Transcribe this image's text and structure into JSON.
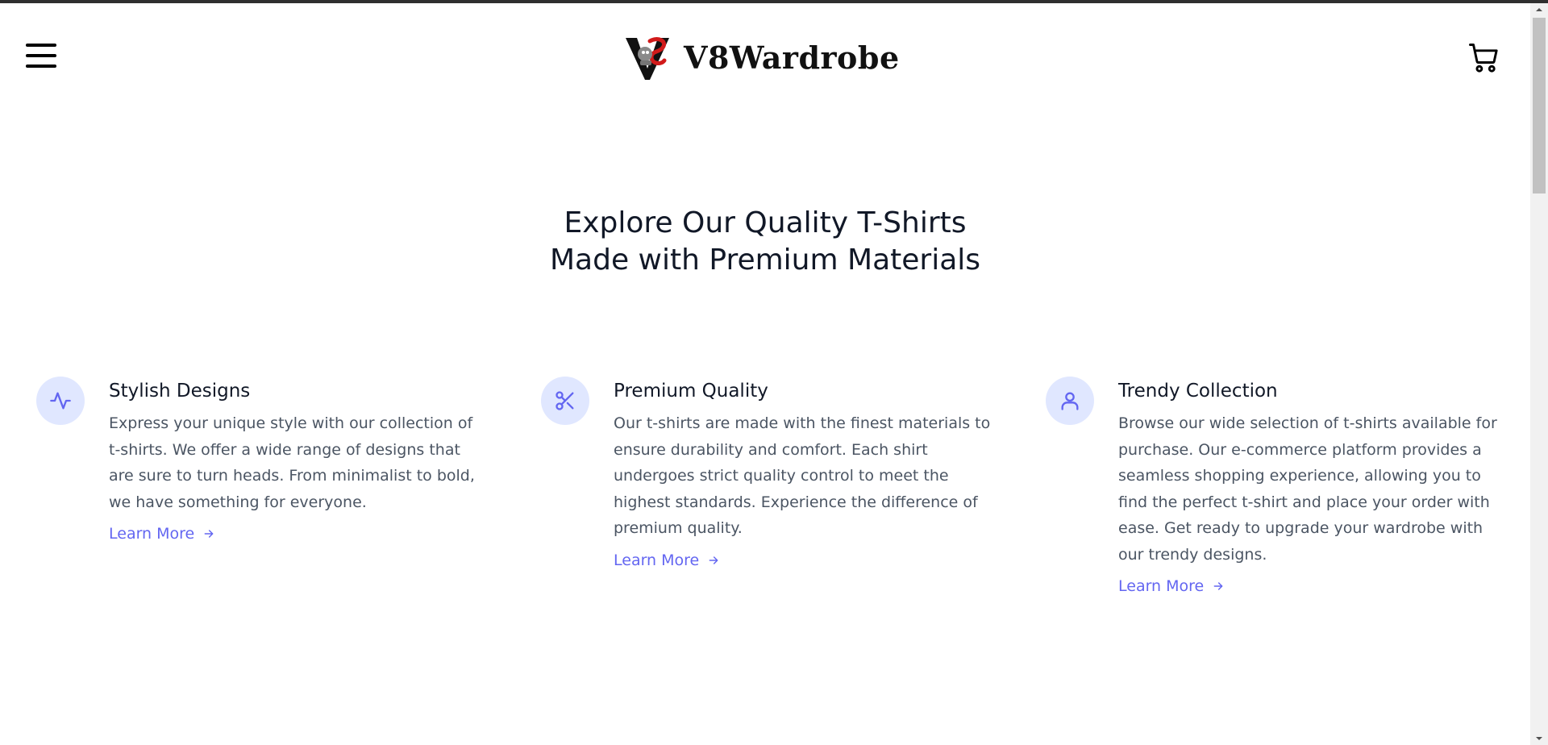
{
  "header": {
    "brand_name": "V8Wardrobe",
    "menu_icon": "hamburger-menu-icon",
    "cart_icon": "shopping-cart-icon"
  },
  "hero": {
    "title_line1": "Explore Our Quality T-Shirts",
    "title_line2": "Made with Premium Materials"
  },
  "features": [
    {
      "icon": "activity-pulse-icon",
      "title": "Stylish Designs",
      "text": "Express your unique style with our collection of t-shirts. We offer a wide range of designs that are sure to turn heads. From minimalist to bold, we have something for everyone.",
      "link": "Learn More"
    },
    {
      "icon": "scissors-icon",
      "title": "Premium Quality",
      "text": "Our t-shirts are made with the finest materials to ensure durability and comfort. Each shirt undergoes strict quality control to meet the highest standards. Experience the difference of premium quality.",
      "link": "Learn More"
    },
    {
      "icon": "user-icon",
      "title": "Trendy Collection",
      "text": "Browse our wide selection of t-shirts available for purchase. Our e-commerce platform provides a seamless shopping experience, allowing you to find the perfect t-shirt and place your order with ease. Get ready to upgrade your wardrobe with our trendy designs.",
      "link": "Learn More"
    }
  ],
  "colors": {
    "accent": "#6366f1",
    "icon_bg": "#e0e7ff",
    "body_text": "#4b5563",
    "heading_text": "#111827"
  }
}
